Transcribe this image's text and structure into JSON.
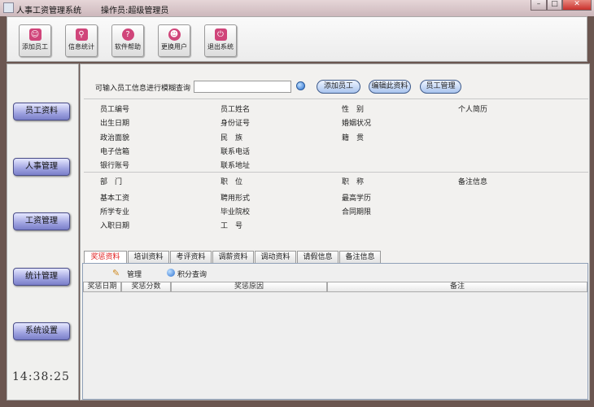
{
  "window": {
    "title": "人事工资管理系统",
    "operator": "操作员:超级管理员",
    "controls": [
      "minimize",
      "maximize",
      "close"
    ]
  },
  "toolbar": [
    {
      "label": "添加员工",
      "icon": "add-user-icon"
    },
    {
      "label": "信息统计",
      "icon": "search-icon"
    },
    {
      "label": "软件帮助",
      "icon": "help-icon"
    },
    {
      "label": "更换用户",
      "icon": "switch-user-icon"
    },
    {
      "label": "退出系统",
      "icon": "exit-icon"
    }
  ],
  "sidebar": {
    "items": [
      "员工资料",
      "人事管理",
      "工资管理",
      "统计管理",
      "系统设置"
    ],
    "clock": "14:38:25"
  },
  "search": {
    "label": "可输入员工信息进行模糊查询",
    "value": "",
    "buttons": [
      "添加员工",
      "编辑此资料",
      "员工管理"
    ]
  },
  "fields1": [
    [
      "员工编号",
      "员工姓名",
      "性　别",
      "个人简历"
    ],
    [
      "出生日期",
      "身份证号",
      "婚姻状况",
      ""
    ],
    [
      "政治面貌",
      "民　族",
      "籍　贯",
      ""
    ],
    [
      "电子信箱",
      "联系电话",
      "",
      ""
    ],
    [
      "银行账号",
      "联系地址",
      "",
      ""
    ]
  ],
  "fields2": [
    [
      "部　门",
      "职　位",
      "职　称",
      "备注信息"
    ],
    [
      "基本工资",
      "聘用形式",
      "最高学历",
      ""
    ],
    [
      "所学专业",
      "毕业院校",
      "合同期限",
      ""
    ],
    [
      "入职日期",
      "工　号",
      "",
      ""
    ]
  ],
  "tabs": [
    "奖惩资料",
    "培训资料",
    "考评资料",
    "调薪资料",
    "调动资料",
    "请假信息",
    "备注信息"
  ],
  "active_tab": "奖惩资料",
  "tab_actions": [
    "管理",
    "积分查询"
  ],
  "table": {
    "columns": [
      "奖惩日期",
      "奖惩分数",
      "奖惩原因",
      "备注"
    ],
    "rows": []
  },
  "colors": {
    "active_tab": "#e02020",
    "sidebar_button": "#9fa3e0",
    "toolbar_icon": "#d0457a",
    "close_button": "#c9302c"
  }
}
